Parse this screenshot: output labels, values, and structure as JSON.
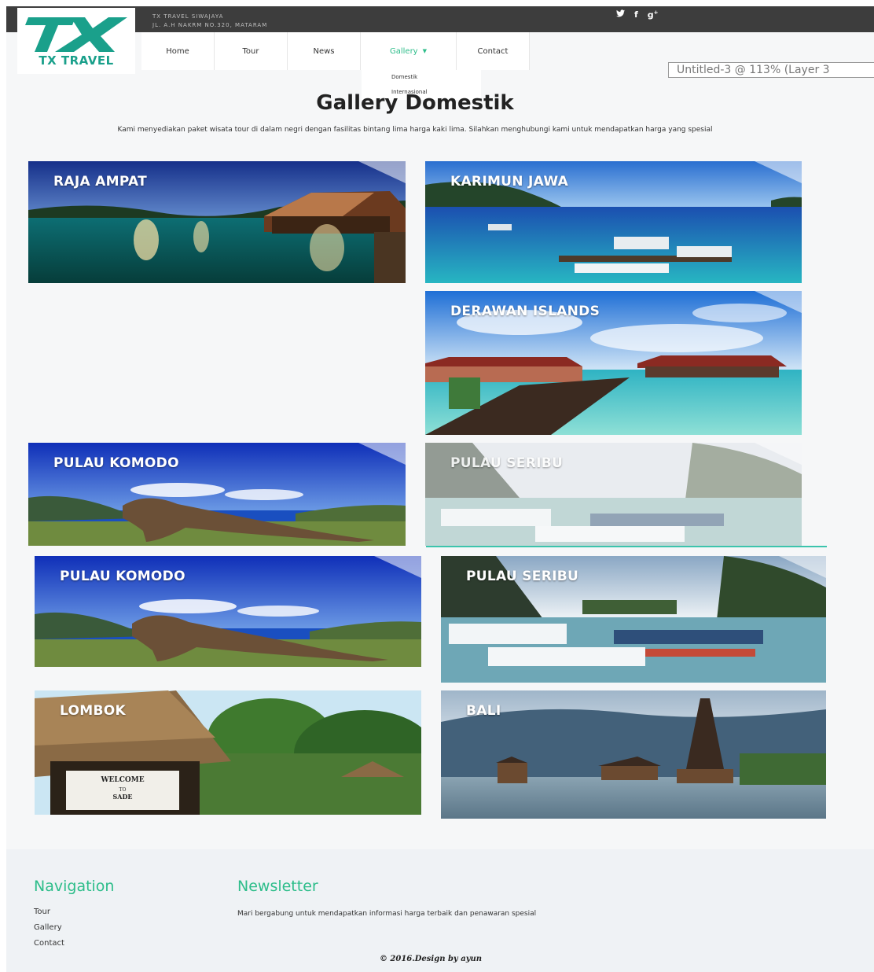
{
  "topbar": {
    "address_line1": "TX TRAVEL SIWAJAYA",
    "address_line2": "JL. A.H NAKRM NO.320, MATARAM",
    "social": [
      "twitter-icon",
      "facebook-icon",
      "google-plus-icon"
    ]
  },
  "logo": {
    "text": "TX TRAVEL"
  },
  "nav": {
    "items": [
      "Home",
      "Tour",
      "News",
      "Gallery",
      "Contact"
    ],
    "active": "Gallery",
    "dropdown": [
      "Domestik",
      "Internasional"
    ]
  },
  "overlay_label": "Untitled-3 @ 113% (Layer 3",
  "heading": {
    "title": "Gallery Domestik",
    "description": "Kami menyediakan paket wisata tour di dalam negri dengan fasilitas bintang lima harga kaki lima. Silahkan menghubungi kami untuk mendapatkan harga yang spesial"
  },
  "gallery": [
    {
      "label": "RAJA AMPAT"
    },
    {
      "label": "KARIMUN JAWA"
    },
    {
      "label": "DERAWAN ISLANDS"
    },
    {
      "label": "PULAU KOMODO"
    },
    {
      "label": "PULAU SERIBU"
    },
    {
      "label": "PULAU KOMODO"
    },
    {
      "label": "PULAU SERIBU"
    },
    {
      "label": "LOMBOK"
    },
    {
      "label": "BALI"
    }
  ],
  "footer": {
    "nav_title": "Navigation",
    "nav_links": [
      "Tour",
      "Gallery",
      "Contact"
    ],
    "newsletter_title": "Newsletter",
    "newsletter_text": "Mari bergabung untuk mendapatkan informasi harga terbaik dan penawaran spesial",
    "copyright": "© 2016.Design by ayun"
  },
  "colors": {
    "accent": "#2dbd8a",
    "topbar": "#3d3d3d",
    "logo": "#1aa08b"
  }
}
